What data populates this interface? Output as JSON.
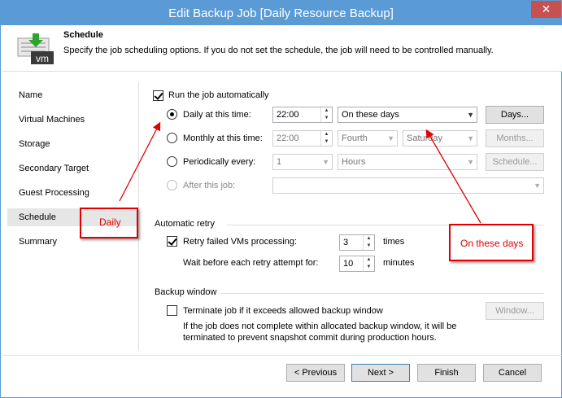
{
  "window": {
    "title": "Edit Backup Job [Daily Resource Backup]",
    "close_glyph": "✕"
  },
  "header": {
    "title": "Schedule",
    "description": "Specify the job scheduling options. If you do not set the schedule, the job will need to be controlled manually.",
    "icon_text": "vm"
  },
  "sidebar": {
    "items": [
      {
        "label": "Name"
      },
      {
        "label": "Virtual Machines"
      },
      {
        "label": "Storage"
      },
      {
        "label": "Secondary Target"
      },
      {
        "label": "Guest Processing"
      },
      {
        "label": "Schedule",
        "selected": true
      },
      {
        "label": "Summary"
      }
    ]
  },
  "schedule": {
    "run_automatically": {
      "label": "Run the job automatically",
      "checked": true
    },
    "daily": {
      "label": "Daily at this time:",
      "time": "22:00",
      "days_option": "On these days",
      "button": "Days..."
    },
    "monthly": {
      "label": "Monthly at this time:",
      "time": "22:00",
      "week": "Fourth",
      "day": "Saturday",
      "button": "Months..."
    },
    "periodically": {
      "label": "Periodically every:",
      "value": "1",
      "unit": "Hours",
      "button": "Schedule..."
    },
    "after_job": {
      "label": "After this job:",
      "value": ""
    }
  },
  "retry": {
    "section_title": "Automatic retry",
    "retry_failed": {
      "label": "Retry failed VMs processing:",
      "checked": true,
      "value": "3",
      "unit": "times"
    },
    "wait": {
      "label": "Wait before each retry attempt for:",
      "value": "10",
      "unit": "minutes"
    }
  },
  "backup_window": {
    "section_title": "Backup window",
    "terminate": {
      "label": "Terminate job if it exceeds allowed backup window",
      "checked": false
    },
    "button": "Window...",
    "note_line1": "If the job does not complete within allocated backup window, it will be",
    "note_line2": "terminated to prevent snapshot commit during production hours."
  },
  "footer": {
    "previous": "< Previous",
    "next": "Next >",
    "finish": "Finish",
    "cancel": "Cancel"
  },
  "annotations": {
    "daily": "Daily",
    "on_these_days": "On these days",
    "color": "#e00000"
  }
}
